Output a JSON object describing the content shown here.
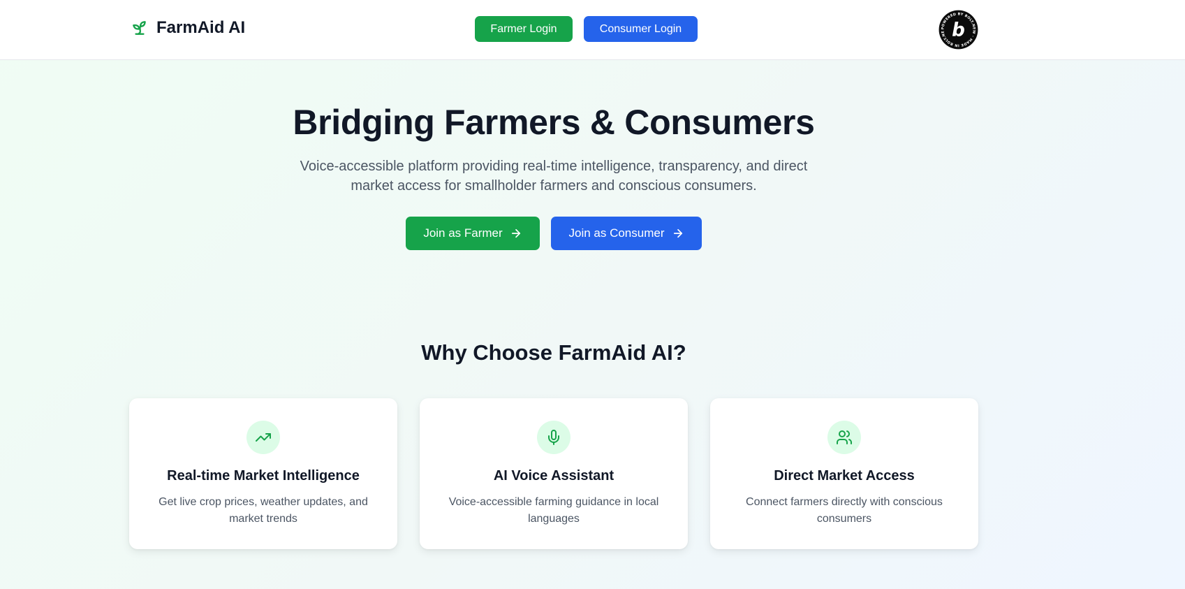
{
  "header": {
    "brand_name": "FarmAid AI",
    "brand_icon": "sprout-icon",
    "farmer_login_label": "Farmer Login",
    "consumer_login_label": "Consumer Login",
    "badge_text": "POWERED BY BOLT.NEW · MADE IN BOLT.NEW ·",
    "badge_letter": "b"
  },
  "hero": {
    "title": "Bridging Farmers & Consumers",
    "subtitle": "Voice-accessible platform providing real-time intelligence, transparency, and direct market access for smallholder farmers and conscious consumers.",
    "join_farmer_label": "Join as Farmer",
    "join_consumer_label": "Join as Consumer",
    "cta_icon": "arrow-right-icon"
  },
  "features": {
    "title": "Why Choose FarmAid AI?",
    "cards": [
      {
        "icon": "trending-up-icon",
        "title": "Real-time Market Intelligence",
        "description": "Get live crop prices, weather updates, and market trends"
      },
      {
        "icon": "microphone-icon",
        "title": "AI Voice Assistant",
        "description": "Voice-accessible farming guidance in local languages"
      },
      {
        "icon": "users-icon",
        "title": "Direct Market Access",
        "description": "Connect farmers directly with conscious consumers"
      }
    ]
  },
  "colors": {
    "green": "#16a34a",
    "blue": "#2563eb",
    "icon_bg": "#dcfce7",
    "heading": "#111827",
    "body_text": "#4b5563"
  }
}
